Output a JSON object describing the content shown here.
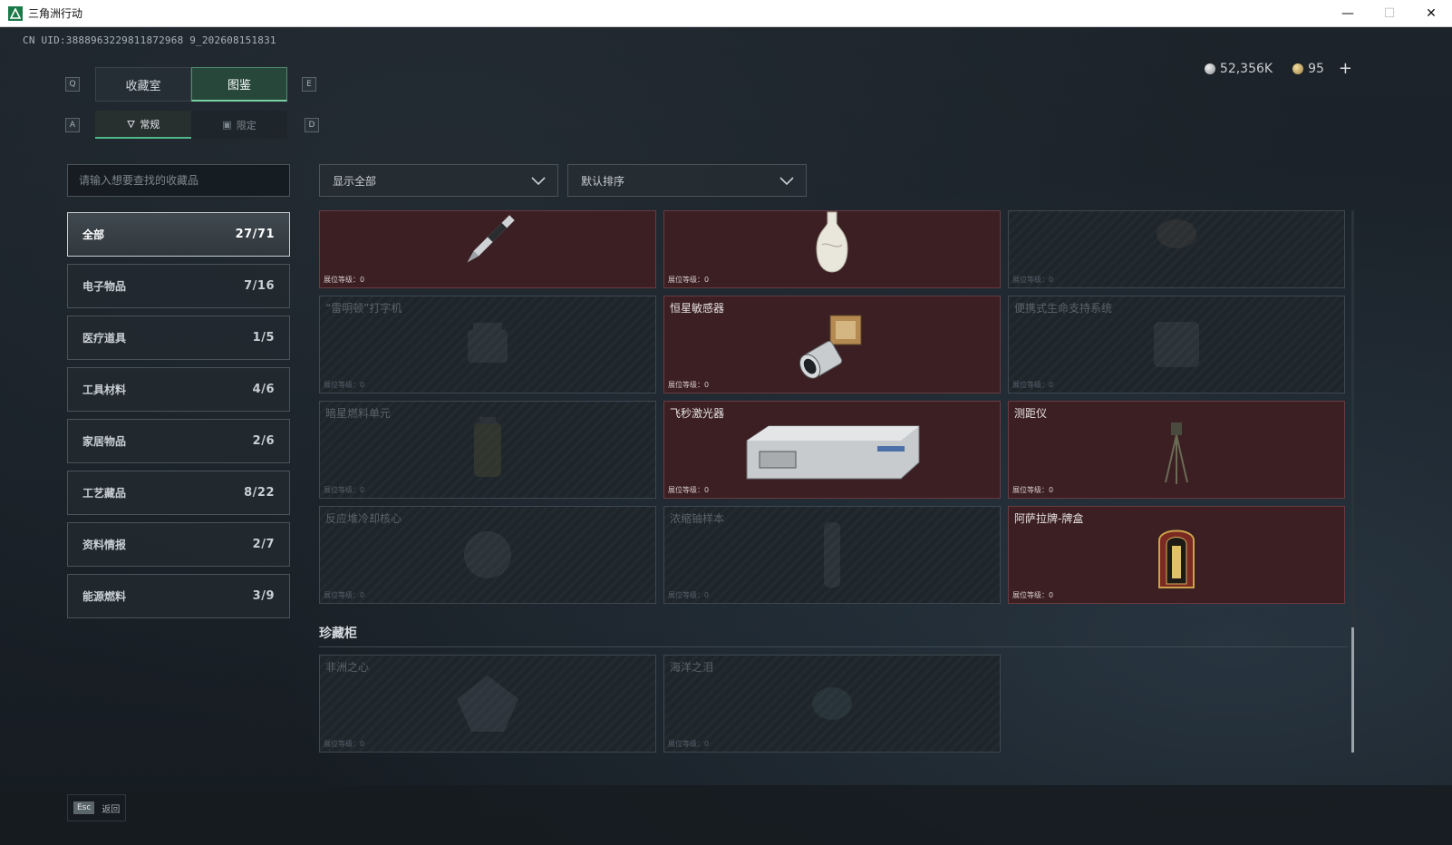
{
  "window": {
    "title": "三角洲行动",
    "minimize": "—",
    "maximize": "☐",
    "close": "✕"
  },
  "uid_text": "CN UID:3888963229811872968 9_202608151831",
  "currency": {
    "silver": "52,356K",
    "gold": "95",
    "plus": "+"
  },
  "keys": {
    "q": "Q",
    "e": "E",
    "a": "A",
    "d": "D"
  },
  "main_tabs": [
    {
      "label": "收藏室"
    },
    {
      "label": "图鉴"
    }
  ],
  "sub_tabs": [
    {
      "label": "常规"
    },
    {
      "label": "限定"
    }
  ],
  "search": {
    "placeholder": "请输入想要查找的收藏品"
  },
  "filters": {
    "show": "显示全部",
    "sort": "默认排序"
  },
  "categories": [
    {
      "label": "全部",
      "count": "27/71"
    },
    {
      "label": "电子物品",
      "count": "7/16"
    },
    {
      "label": "医疗道具",
      "count": "1/5"
    },
    {
      "label": "工具材料",
      "count": "4/6"
    },
    {
      "label": "家居物品",
      "count": "2/6"
    },
    {
      "label": "工艺藏品",
      "count": "8/22"
    },
    {
      "label": "资料情报",
      "count": "2/7"
    },
    {
      "label": "能源燃料",
      "count": "3/9"
    }
  ],
  "items": [
    {
      "name": "",
      "level": "展位等级：0",
      "owned": true,
      "icon": "pen-icon"
    },
    {
      "name": "",
      "level": "展位等级：0",
      "owned": true,
      "icon": "vase-icon"
    },
    {
      "name": "",
      "level": "展位等级：0",
      "owned": false,
      "icon": "unknown-icon"
    },
    {
      "name": "“雷明顿”打字机",
      "level": "展位等级：0",
      "owned": false,
      "icon": "typewriter-icon"
    },
    {
      "name": "恒星敏感器",
      "level": "展位等级：0",
      "owned": true,
      "icon": "star-sensor-icon"
    },
    {
      "name": "便携式生命支持系统",
      "level": "展位等级：0",
      "owned": false,
      "icon": "life-support-icon"
    },
    {
      "name": "暗星燃料单元",
      "level": "展位等级：0",
      "owned": false,
      "icon": "fuel-cell-icon"
    },
    {
      "name": "飞秒激光器",
      "level": "展位等级：0",
      "owned": true,
      "icon": "laser-icon"
    },
    {
      "name": "测距仪",
      "level": "展位等级：0",
      "owned": true,
      "icon": "rangefinder-icon"
    },
    {
      "name": "反应堆冷却核心",
      "level": "展位等级：0",
      "owned": false,
      "icon": "reactor-core-icon"
    },
    {
      "name": "浓缩铀样本",
      "level": "展位等级：0",
      "owned": false,
      "icon": "uranium-icon"
    },
    {
      "name": "阿萨拉牌-牌盒",
      "level": "展位等级：0",
      "owned": true,
      "icon": "card-box-icon"
    }
  ],
  "section": {
    "title": "珍藏柜"
  },
  "treasures": [
    {
      "name": "非洲之心",
      "level": "展位等级：0",
      "owned": false,
      "icon": "diamond-icon"
    },
    {
      "name": "海洋之泪",
      "level": "展位等级：0",
      "owned": false,
      "icon": "pearl-icon"
    }
  ],
  "footer": {
    "esc_key": "Esc",
    "back_label": "返回"
  },
  "colors": {
    "owned_card": "#3b1f23",
    "locked_card": "#1e252b",
    "accent_green": "#4fb888"
  }
}
